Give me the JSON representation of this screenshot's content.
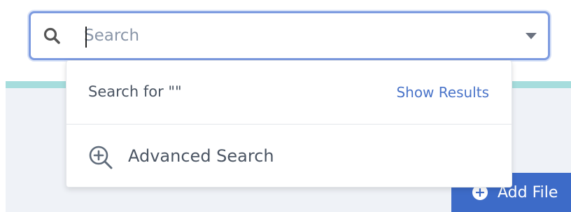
{
  "search": {
    "placeholder": "Search",
    "value": "",
    "icon": "search-icon",
    "dropdown_icon": "chevron-down-icon"
  },
  "dropdown": {
    "search_for_label": "Search for \"\"",
    "show_results_label": "Show Results",
    "advanced_search_label": "Advanced Search",
    "advanced_search_icon": "zoom-in-icon"
  },
  "actions": {
    "add_file_label": "Add File",
    "add_file_icon": "plus-circle-icon"
  },
  "colors": {
    "accent": "#3d6bc8",
    "link": "#4a74c9",
    "focus_border": "#7d9be0",
    "teal_bar": "#a6dddd",
    "panel_bg": "#eff2f7"
  }
}
